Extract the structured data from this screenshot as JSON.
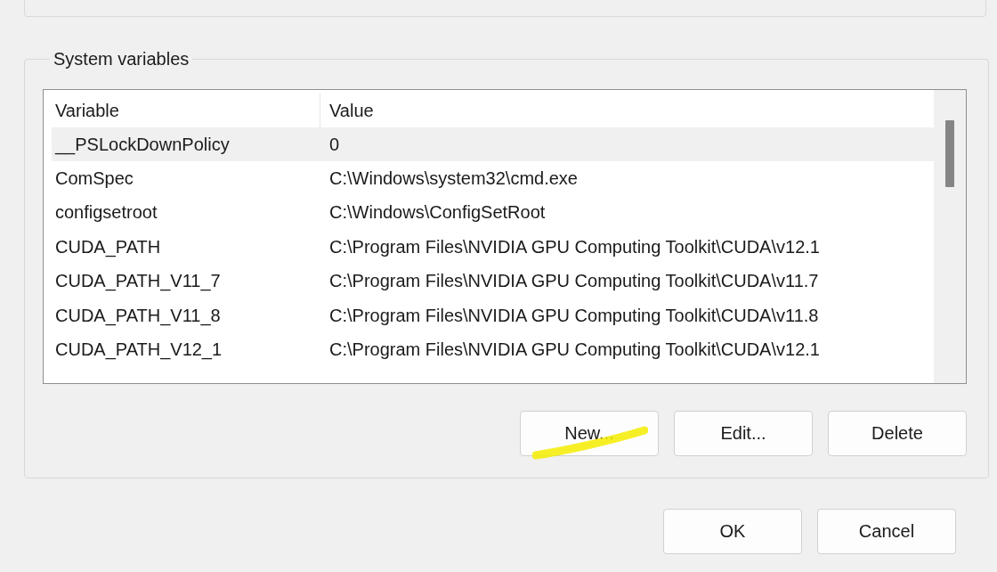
{
  "group": {
    "title": "System variables"
  },
  "table": {
    "columns": [
      "Variable",
      "Value"
    ],
    "rows": [
      {
        "variable": "__PSLockDownPolicy",
        "value": "0",
        "selected": true
      },
      {
        "variable": "ComSpec",
        "value": "C:\\Windows\\system32\\cmd.exe",
        "selected": false
      },
      {
        "variable": "configsetroot",
        "value": "C:\\Windows\\ConfigSetRoot",
        "selected": false
      },
      {
        "variable": "CUDA_PATH",
        "value": "C:\\Program Files\\NVIDIA GPU Computing Toolkit\\CUDA\\v12.1",
        "selected": false
      },
      {
        "variable": "CUDA_PATH_V11_7",
        "value": "C:\\Program Files\\NVIDIA GPU Computing Toolkit\\CUDA\\v11.7",
        "selected": false
      },
      {
        "variable": "CUDA_PATH_V11_8",
        "value": "C:\\Program Files\\NVIDIA GPU Computing Toolkit\\CUDA\\v11.8",
        "selected": false
      },
      {
        "variable": "CUDA_PATH_V12_1",
        "value": "C:\\Program Files\\NVIDIA GPU Computing Toolkit\\CUDA\\v12.1",
        "selected": false
      }
    ]
  },
  "group_buttons": [
    "New...",
    "Edit...",
    "Delete"
  ],
  "dialog_buttons": [
    "OK",
    "Cancel"
  ]
}
